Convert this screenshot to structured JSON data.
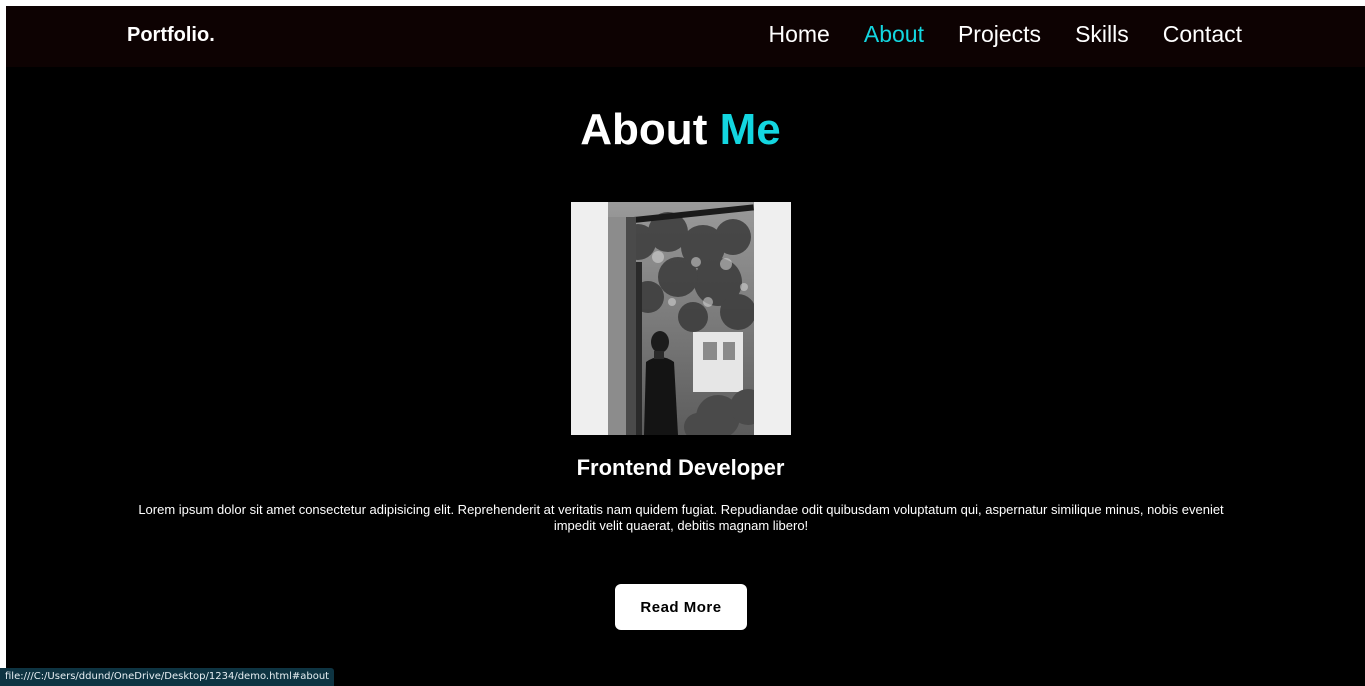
{
  "navbar": {
    "logo": "Portfolio.",
    "links": [
      {
        "label": "Home",
        "active": false
      },
      {
        "label": "About",
        "active": true
      },
      {
        "label": "Projects",
        "active": false
      },
      {
        "label": "Skills",
        "active": false
      },
      {
        "label": "Contact",
        "active": false
      }
    ]
  },
  "about": {
    "heading_main": "About",
    "heading_accent": "Me",
    "role": "Frontend Developer",
    "text": "Lorem ipsum dolor sit amet consectetur adipisicing elit. Reprehenderit at veritatis nam quidem fugiat. Repudiandae odit quibusdam voluptatum qui, aspernatur similique minus, nobis eveniet impedit velit quaerat, debitis magnam libero!",
    "button_label": "Read More"
  },
  "status_bar": {
    "url": "file:///C:/Users/ddund/OneDrive/Desktop/1234/demo.html#about"
  },
  "colors": {
    "accent": "#13d6e0",
    "background": "#000000",
    "navbar": "#0d0202"
  }
}
